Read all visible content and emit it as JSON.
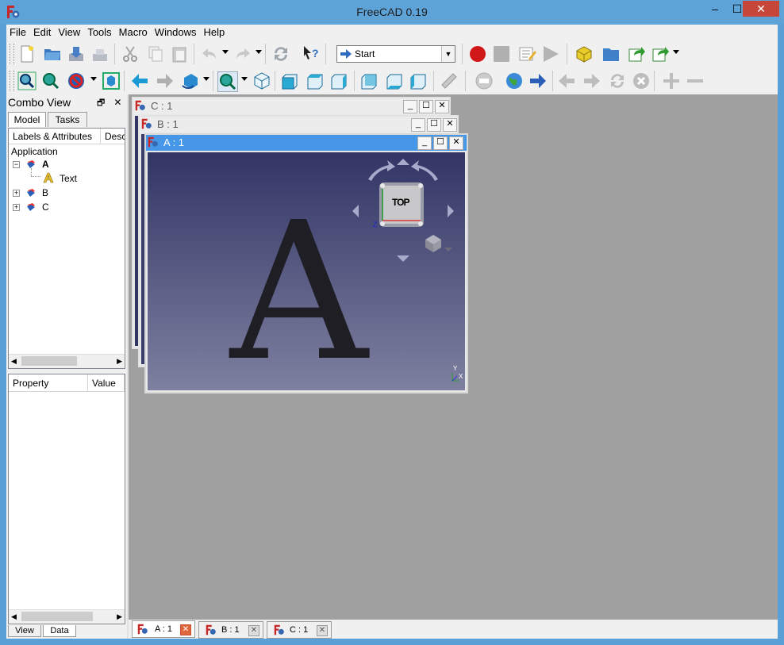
{
  "window": {
    "title": "FreeCAD 0.19",
    "minimize": "–",
    "maximize": "☐",
    "close": "✕"
  },
  "menu": [
    "File",
    "Edit",
    "View",
    "Tools",
    "Macro",
    "Windows",
    "Help"
  ],
  "workbench": {
    "selected": "Start"
  },
  "combo_view": {
    "title": "Combo View",
    "tabs": [
      "Model",
      "Tasks"
    ],
    "active_tab": "Model",
    "tree": {
      "headers": [
        "Labels & Attributes",
        "Desc"
      ],
      "root": "Application",
      "items": [
        {
          "label": "A",
          "expanded": true,
          "bold": true,
          "children": [
            "Text"
          ]
        },
        {
          "label": "B",
          "expanded": false,
          "bold": false
        },
        {
          "label": "C",
          "expanded": false,
          "bold": false
        }
      ]
    },
    "property_headers": [
      "Property",
      "Value"
    ],
    "bottom_tabs": [
      "View",
      "Data"
    ],
    "active_bottom_tab": "Data"
  },
  "subwindows": [
    {
      "title": "C : 1"
    },
    {
      "title": "B : 1"
    },
    {
      "title": "A : 1",
      "active": true
    }
  ],
  "view3d": {
    "shape_text": "A",
    "navcube_face": "TOP",
    "axis_x": "X",
    "axis_y": "Y",
    "axis_z": "Z"
  },
  "mdi_tabs": [
    {
      "label": "A : 1",
      "active": true
    },
    {
      "label": "B : 1",
      "active": false
    },
    {
      "label": "C : 1",
      "active": false
    }
  ],
  "colors": {
    "titlebar": "#5ea3d8",
    "active_caption": "#4797e8",
    "close_button": "#c7463a",
    "record": "#d01818"
  }
}
